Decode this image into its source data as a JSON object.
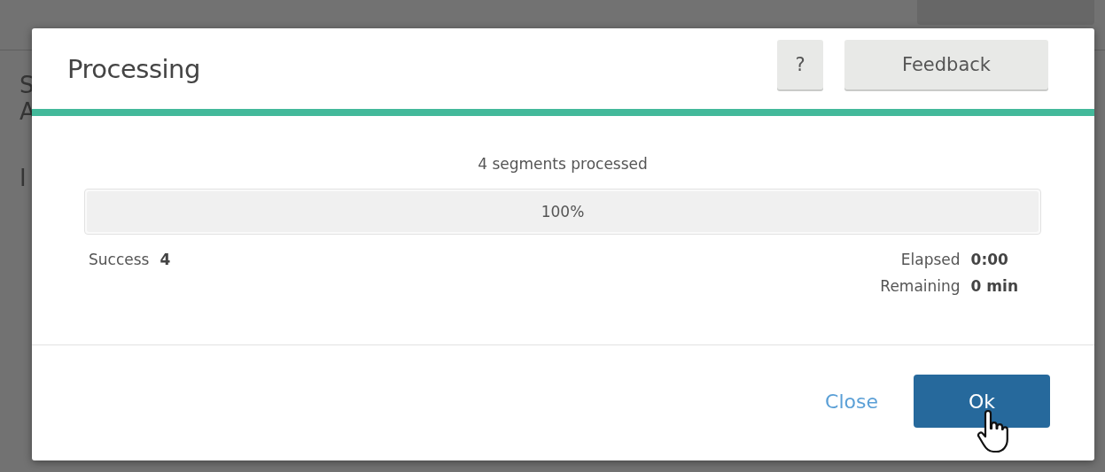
{
  "background": {
    "letters": [
      "S",
      "A",
      "I"
    ]
  },
  "dialog": {
    "title": "Processing",
    "help_button": "?",
    "feedback_button": "Feedback",
    "message": "4 segments processed",
    "progress": {
      "level": 1,
      "label": "100%"
    },
    "stats_left": [
      {
        "label": "Success",
        "value": "4"
      }
    ],
    "stats_right": [
      {
        "label": "Elapsed",
        "value": "0:00"
      },
      {
        "label": "Remaining",
        "value": "0 min"
      }
    ],
    "close_link": "Close",
    "ok_button": "Ok"
  }
}
